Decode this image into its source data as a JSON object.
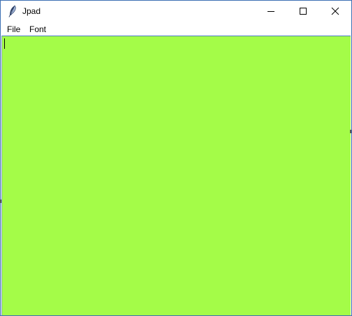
{
  "window": {
    "title": "Jpad",
    "app_icon": "feather-icon",
    "controls": {
      "minimize_icon": "minimize-icon",
      "maximize_icon": "maximize-icon",
      "close_icon": "close-icon"
    }
  },
  "menu": {
    "items": [
      {
        "label": "File"
      },
      {
        "label": "Font"
      }
    ]
  },
  "editor": {
    "content": "",
    "background_color": "#a4fc48"
  }
}
